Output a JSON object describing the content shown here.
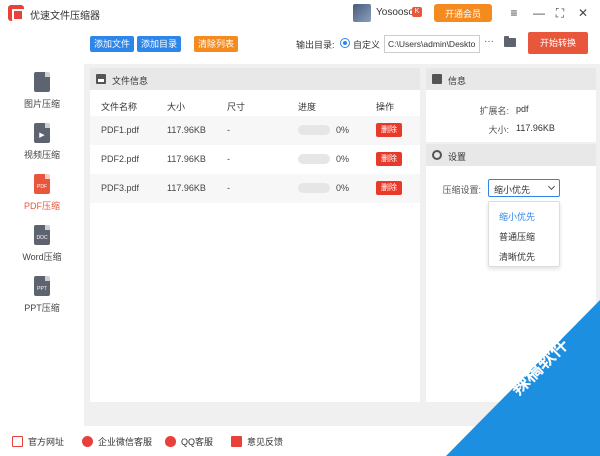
{
  "titlebar": {
    "app_title": "优速文件压缩器",
    "username": "Yosoosoft",
    "user_badge": "K",
    "vip_label": "开通会员",
    "menu_icon": "≡",
    "min_icon": "—",
    "max_icon": "⛶",
    "close_icon": "✕"
  },
  "sidebar": {
    "items": [
      {
        "label": "图片压缩",
        "icon": "image-file-icon",
        "icon_text": "",
        "active": false
      },
      {
        "label": "视频压缩",
        "icon": "video-file-icon",
        "icon_text": "▶",
        "active": false
      },
      {
        "label": "PDF压缩",
        "icon": "pdf-file-icon",
        "icon_text": "PDF",
        "active": true
      },
      {
        "label": "Word压缩",
        "icon": "doc-file-icon",
        "icon_text": "DOC",
        "active": false
      },
      {
        "label": "PPT压缩",
        "icon": "ppt-file-icon",
        "icon_text": "PPT",
        "active": false
      }
    ]
  },
  "toolbar": {
    "add_file": "添加文件",
    "add_dir": "添加目录",
    "clear_list": "清除列表",
    "output_label": "输出目录:",
    "custom_label": "自定义",
    "path_value": "C:\\Users\\admin\\Deskto",
    "more": "···",
    "start": "开始转换"
  },
  "file_panel": {
    "title": "文件信息",
    "columns": [
      "文件名称",
      "大小",
      "尺寸",
      "进度",
      "操作"
    ],
    "rows": [
      {
        "name": "PDF1.pdf",
        "size": "117.96KB",
        "dim": "-",
        "progress": "0%",
        "progress_value": 0,
        "action": "删除"
      },
      {
        "name": "PDF2.pdf",
        "size": "117.96KB",
        "dim": "-",
        "progress": "0%",
        "progress_value": 0,
        "action": "删除"
      },
      {
        "name": "PDF3.pdf",
        "size": "117.96KB",
        "dim": "-",
        "progress": "0%",
        "progress_value": 0,
        "action": "删除"
      }
    ]
  },
  "info_panel": {
    "title": "信息",
    "ext_label": "扩展名:",
    "ext_value": "pdf",
    "size_label": "大小:",
    "size_value": "117.96KB"
  },
  "settings_panel": {
    "title": "设置",
    "compress_label": "压缩设置:",
    "selected": "缩小优先",
    "options": [
      "缩小优先",
      "普通压缩",
      "清晰优先"
    ]
  },
  "footer": {
    "items": [
      "官方网址",
      "企业微信客服",
      "QQ客服",
      "意见反馈"
    ]
  },
  "watermark": {
    "text": "辣稿软件"
  },
  "colors": {
    "accent_blue": "#2f86e9",
    "accent_orange": "#f58a1f",
    "accent_red": "#e8573c",
    "watermark_blue": "#1c8fe0"
  }
}
